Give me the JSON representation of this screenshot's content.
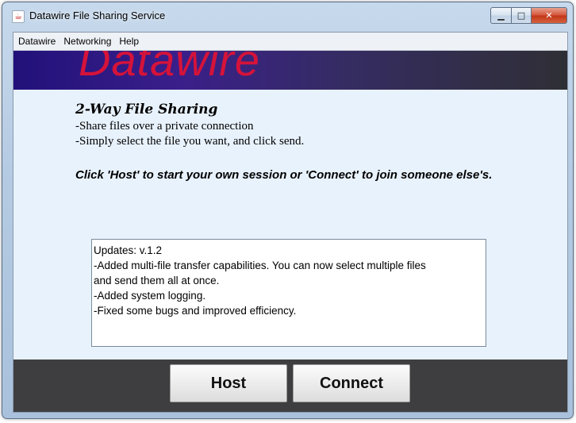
{
  "window": {
    "title": "Datawire File Sharing Service",
    "icon": "java-cup-icon",
    "controls": {
      "minimize": "▁",
      "maximize": "□",
      "close": "✕"
    }
  },
  "menubar": {
    "items": [
      "Datawire",
      "Networking",
      "Help"
    ]
  },
  "banner": {
    "logo_text": "Datawire",
    "logo_color": "#d5133a",
    "background_start": "#22117a",
    "background_end": "#2f2f35"
  },
  "intro": {
    "heading": "2-Way File Sharing",
    "bullets": [
      "-Share files over a private connection",
      "-Simply select the file you want, and click send."
    ],
    "instruction": "Click 'Host' to start your own session or 'Connect' to join someone else's."
  },
  "updates": {
    "lines": [
      "Updates: v.1.2",
      "-Added multi-file transfer capabilities.  You can now select multiple files",
      "and send them all at once.",
      "-Added system logging.",
      "-Fixed some bugs and improved efficiency."
    ]
  },
  "actions": {
    "host_label": "Host",
    "connect_label": "Connect"
  }
}
